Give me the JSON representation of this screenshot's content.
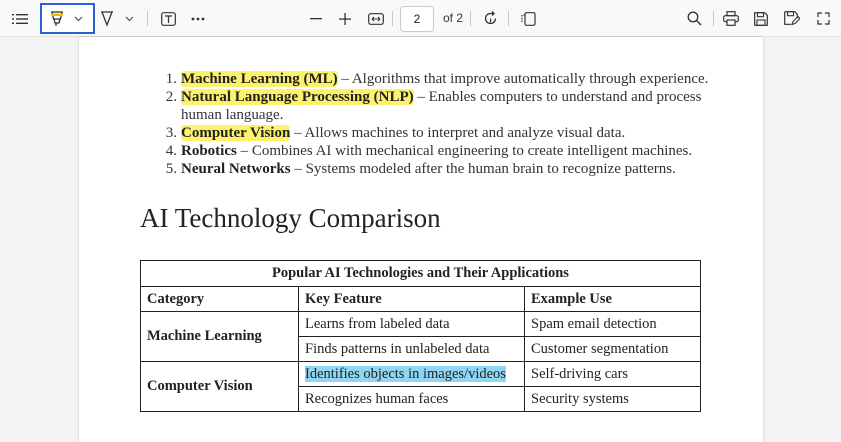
{
  "toolbar": {
    "icons": [
      "list-icon",
      "highlighter-icon",
      "chevron-down-icon",
      "draw-icon",
      "chevron-down-icon",
      "text-icon",
      "more-icon",
      "minus-icon",
      "plus-icon",
      "fit-page-icon",
      "rotate-icon",
      "page-view-icon",
      "search-icon",
      "print-icon",
      "save-icon",
      "save-as-icon",
      "expand-icon"
    ],
    "page_current": "2",
    "page_total_label": "of 2",
    "accent_color": "#2f5fd6"
  },
  "list": [
    {
      "num": "1.",
      "term": "Machine Learning (ML)",
      "desc": " – Algorithms that improve automatically through experience.",
      "highlight": true
    },
    {
      "num": "2.",
      "term": "Natural Language Processing (NLP)",
      "desc": " – Enables computers to understand and process human language.",
      "highlight": true
    },
    {
      "num": "3.",
      "term": "Computer Vision",
      "desc": " – Allows machines to interpret and analyze visual data.",
      "highlight": true
    },
    {
      "num": "4.",
      "term": "Robotics",
      "desc": " – Combines AI with mechanical engineering to create intelligent machines.",
      "highlight": false
    },
    {
      "num": "5.",
      "term": "Neural Networks",
      "desc": " – Systems modeled after the human brain to recognize patterns.",
      "highlight": false
    }
  ],
  "heading": "AI Technology Comparison",
  "table": {
    "caption": "Popular AI Technologies and Their Applications",
    "headers": [
      "Category",
      "Key Feature",
      "Example Use"
    ],
    "groups": [
      {
        "category": "Machine Learning",
        "rows": [
          {
            "feature": "Learns from labeled data",
            "use": "Spam email detection"
          },
          {
            "feature": "Finds patterns in unlabeled data",
            "use": "Customer segmentation"
          }
        ]
      },
      {
        "category": "Computer Vision",
        "rows": [
          {
            "feature": "Identifies objects in images/videos",
            "use": "Self-driving cars"
          },
          {
            "feature": "Recognizes human faces",
            "use": "Security systems"
          }
        ]
      }
    ]
  },
  "colors": {
    "highlight_yellow": "#fdf26b",
    "highlight_blue": "#8fd6f5"
  }
}
